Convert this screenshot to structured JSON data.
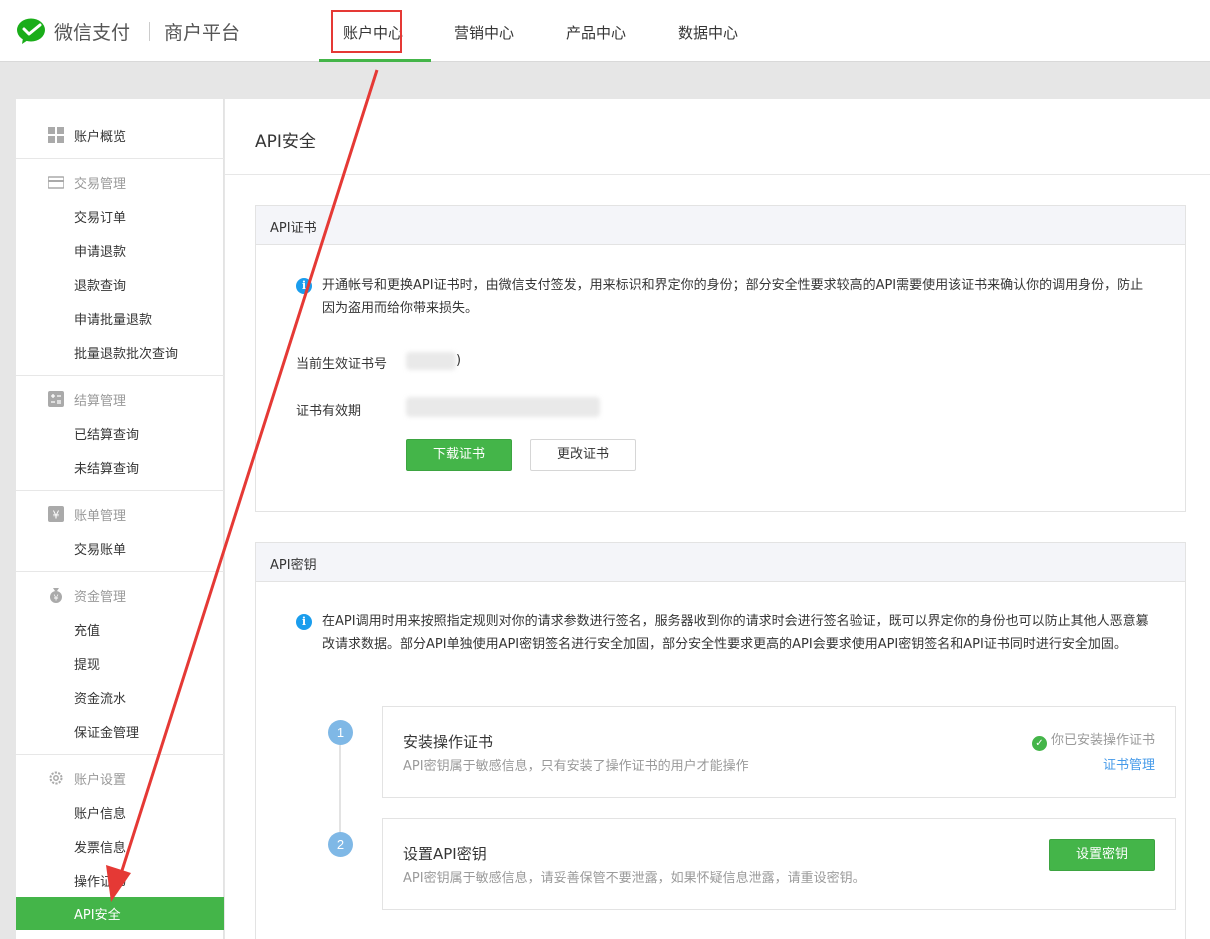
{
  "header": {
    "brand": "微信支付",
    "brand_sub": "商户平台",
    "nav": [
      "账户中心",
      "营销中心",
      "产品中心",
      "数据中心"
    ],
    "active_nav": "账户中心"
  },
  "sidebar": {
    "overview": "账户概览",
    "groups": [
      {
        "title": "交易管理",
        "icon": "trade-icon",
        "items": [
          "交易订单",
          "申请退款",
          "退款查询",
          "申请批量退款",
          "批量退款批次查询"
        ]
      },
      {
        "title": "结算管理",
        "icon": "settle-icon",
        "items": [
          "已结算查询",
          "未结算查询"
        ]
      },
      {
        "title": "账单管理",
        "icon": "bill-icon",
        "items": [
          "交易账单"
        ]
      },
      {
        "title": "资金管理",
        "icon": "fund-icon",
        "items": [
          "充值",
          "提现",
          "资金流水",
          "保证金管理"
        ]
      },
      {
        "title": "账户设置",
        "icon": "gear-icon",
        "items": [
          "账户信息",
          "发票信息",
          "操作证书"
        ]
      }
    ],
    "active_item": "API安全"
  },
  "main": {
    "title": "API安全",
    "cert_panel": {
      "title": "API证书",
      "info": "开通帐号和更换API证书时，由微信支付签发，用来标识和界定你的身份；部分安全性要求较高的API需要使用该证书来确认你的调用身份，防止因为盗用而给你带来损失。",
      "serial_label": "当前生效证书号",
      "serial_tail": ")",
      "validity_label": "证书有效期",
      "download_button": "下载证书",
      "change_button": "更改证书"
    },
    "key_panel": {
      "title": "API密钥",
      "info": "在API调用时用来按照指定规则对你的请求参数进行签名，服务器收到你的请求时会进行签名验证，既可以界定你的身份也可以防止其他人恶意篡改请求数据。部分API单独使用API密钥签名进行安全加固，部分安全性要求更高的API会要求使用API密钥签名和API证书同时进行安全加固。",
      "steps": [
        {
          "num": "1",
          "title": "安装操作证书",
          "desc": "API密钥属于敏感信息，只有安装了操作证书的用户才能操作",
          "status": "你已安装操作证书",
          "link": "证书管理"
        },
        {
          "num": "2",
          "title": "设置API密钥",
          "desc": "API密钥属于敏感信息，请妥善保管不要泄露，如果怀疑信息泄露，请重设密钥。",
          "button": "设置密钥"
        }
      ]
    }
  },
  "colors": {
    "accent": "#44b549",
    "link": "#459ae9",
    "annotation": "#e53935"
  }
}
